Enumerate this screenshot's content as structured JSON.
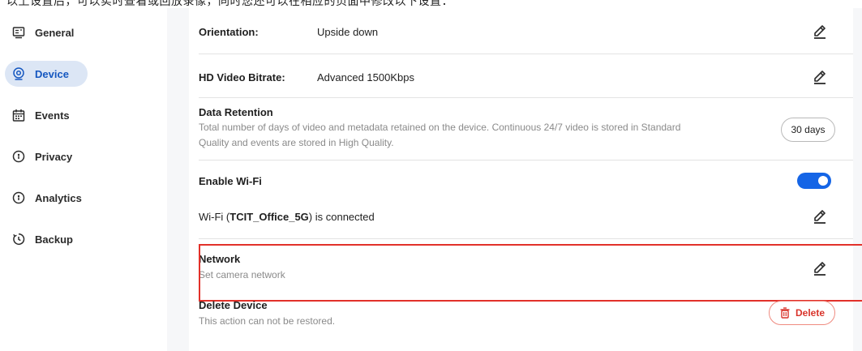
{
  "top_text": "以上设置后，可以实时查看或回放录像，同时您还可以在相应的页面中修改以下设置：",
  "sidebar": {
    "items": [
      {
        "label": "General",
        "icon": "general-icon"
      },
      {
        "label": "Device",
        "icon": "device-icon",
        "active": true
      },
      {
        "label": "Events",
        "icon": "calendar-icon"
      },
      {
        "label": "Privacy",
        "icon": "shield-icon"
      },
      {
        "label": "Analytics",
        "icon": "shield-icon"
      },
      {
        "label": "Backup",
        "icon": "history-icon"
      }
    ]
  },
  "settings": {
    "orientation": {
      "label": "Orientation:",
      "value": "Upside down"
    },
    "bitrate": {
      "label": "HD Video Bitrate:",
      "value": "Advanced 1500Kbps"
    },
    "retention": {
      "title": "Data Retention",
      "desc_line1": "Total number of days of video and metadata retained on the device. Continuous 24/7 video is stored in Standard",
      "desc_line2": "Quality and events are stored in High Quality.",
      "value": "30 days"
    },
    "wifi": {
      "title": "Enable Wi-Fi",
      "enabled": true,
      "status_prefix": "Wi-Fi (",
      "ssid": "TCIT_Office_5G",
      "status_suffix": ") is connected"
    },
    "network": {
      "title": "Network",
      "desc": "Set camera network"
    },
    "delete": {
      "title": "Delete Device",
      "desc": "This action can not be restored.",
      "button": "Delete"
    }
  },
  "colors": {
    "accent": "#1565e6",
    "active_bg": "#dce6f5",
    "danger": "#e2312a"
  }
}
